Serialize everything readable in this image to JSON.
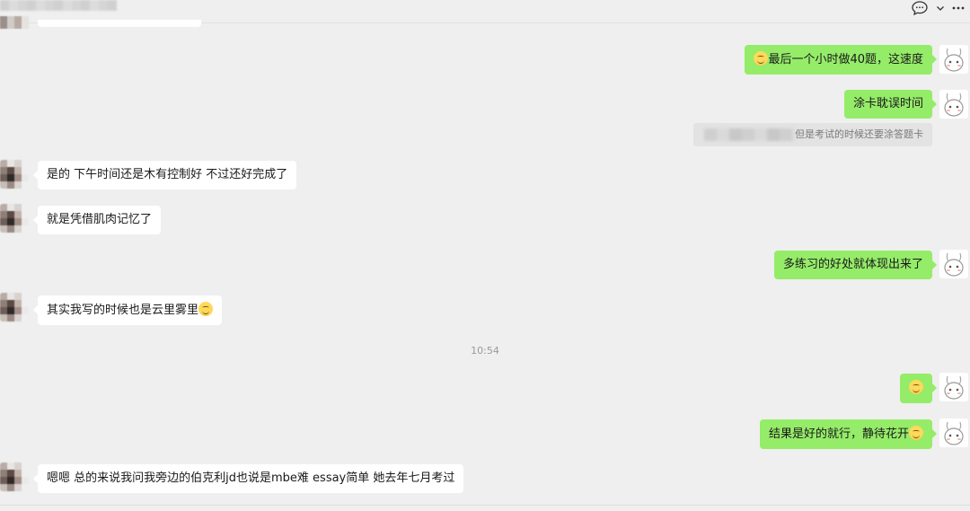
{
  "header": {
    "icons": [
      "chat-bubble-icon",
      "chevron-down-icon",
      "more-icon"
    ]
  },
  "messages": [
    {
      "id": "m1",
      "side": "out",
      "emoji_before": true,
      "text": "最后一个小时做40题，这速度"
    },
    {
      "id": "m2",
      "side": "out",
      "text": "涂卡耽误时间"
    },
    {
      "id": "m3",
      "side": "quote",
      "text": "但是考试的时候还要涂答题卡"
    },
    {
      "id": "m4",
      "side": "in",
      "text": "是的 下午时间还是木有控制好 不过还好完成了"
    },
    {
      "id": "m5",
      "side": "in",
      "text": "就是凭借肌肉记忆了"
    },
    {
      "id": "m6",
      "side": "out",
      "text": "多练习的好处就体现出来了"
    },
    {
      "id": "m7",
      "side": "in",
      "text": "其实我写的时候也是云里雾里",
      "emoji_after": true
    },
    {
      "id": "m8",
      "side": "out",
      "text": "",
      "emoji_only": true
    },
    {
      "id": "m9",
      "side": "out",
      "text": "结果是好的就行，静待花开",
      "emoji_after": true
    },
    {
      "id": "m10",
      "side": "in",
      "text": "嗯嗯 总的来说我问我旁边的伯克利jd也说是mbe难 essay简单 她去年七月考过"
    }
  ],
  "timestamp": "10:54",
  "colors": {
    "background": "#efefef",
    "outgoing": "#95ec69",
    "incoming": "#ffffff"
  }
}
